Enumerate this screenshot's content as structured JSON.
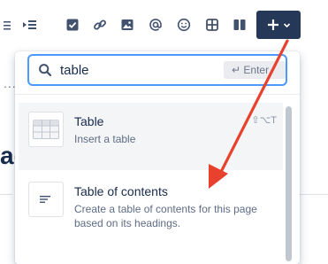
{
  "toolbar": {
    "icons": [
      "list-partial-icon",
      "indent-icon",
      "task-checkbox-icon",
      "link-icon",
      "image-icon",
      "mention-icon",
      "emoji-icon",
      "table-icon",
      "layout-columns-icon"
    ],
    "insert_button_color": "#253858"
  },
  "page_fragment": {
    "dots": "...",
    "title_fragment": "ag"
  },
  "insert_menu": {
    "search": {
      "value": "table",
      "enter_hint": "↵ Enter"
    },
    "items": [
      {
        "title": "Table",
        "description": "Insert a table",
        "shortcut": "⇧⌥T",
        "icon": "table-grid-icon"
      },
      {
        "title": "Table of contents",
        "description": "Create a table of contents for this page based on its headings.",
        "icon": "toc-lines-icon"
      }
    ]
  },
  "annotation": {
    "arrow_color": "#e8412e"
  }
}
